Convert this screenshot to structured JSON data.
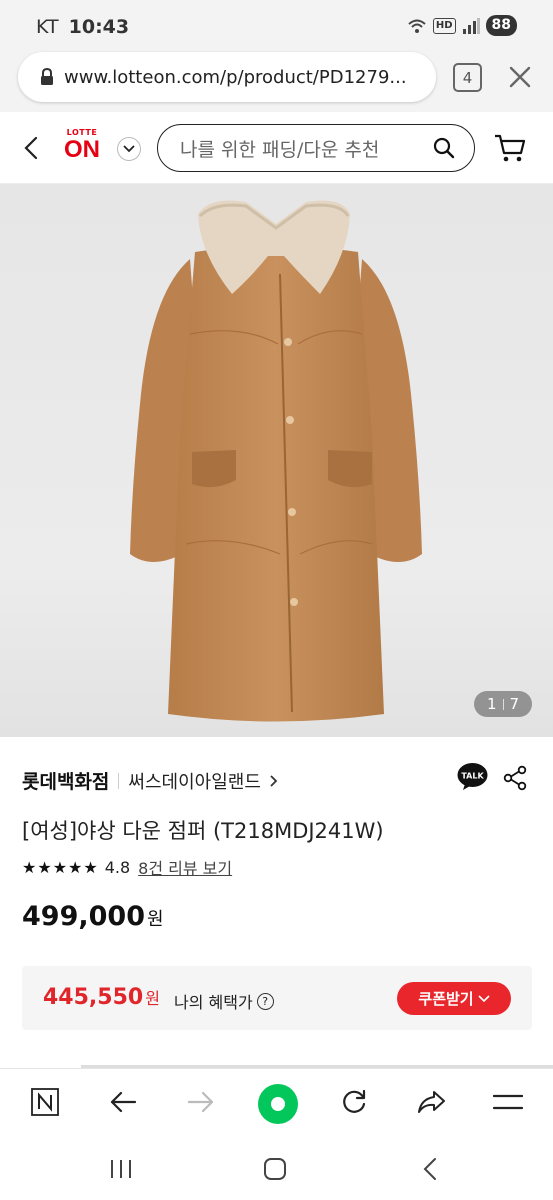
{
  "status_bar": {
    "carrier": "KT",
    "time": "10:43",
    "hd": "HD",
    "battery": "88"
  },
  "browser": {
    "url": "www.lotteon.com/p/product/PD1279...",
    "tab_count": "4"
  },
  "site_header": {
    "logo_top": "LOTTE",
    "logo_main": "ON",
    "search_placeholder": "나를 위한 패딩/다운 추천"
  },
  "gallery": {
    "current": "1",
    "total": "7"
  },
  "product": {
    "brand": "롯데백화점",
    "store": "써스데이아일랜드",
    "name": "[여성]야상 다운 점퍼 (T218MDJ241W)",
    "stars": "★★★★★",
    "rating": "4.8",
    "reviews_link": "8건 리뷰 보기",
    "price": "499,000",
    "price_unit": "원",
    "talk_label": "TALK"
  },
  "benefit": {
    "price": "445,550",
    "price_unit": "원",
    "label": "나의 혜택가",
    "help": "?",
    "coupon_button": "쿠폰받기"
  },
  "colors": {
    "brand_red": "#e60012",
    "coupon_red": "#e8262c",
    "naver_green": "#03c75a",
    "coat": "#c38b57"
  }
}
